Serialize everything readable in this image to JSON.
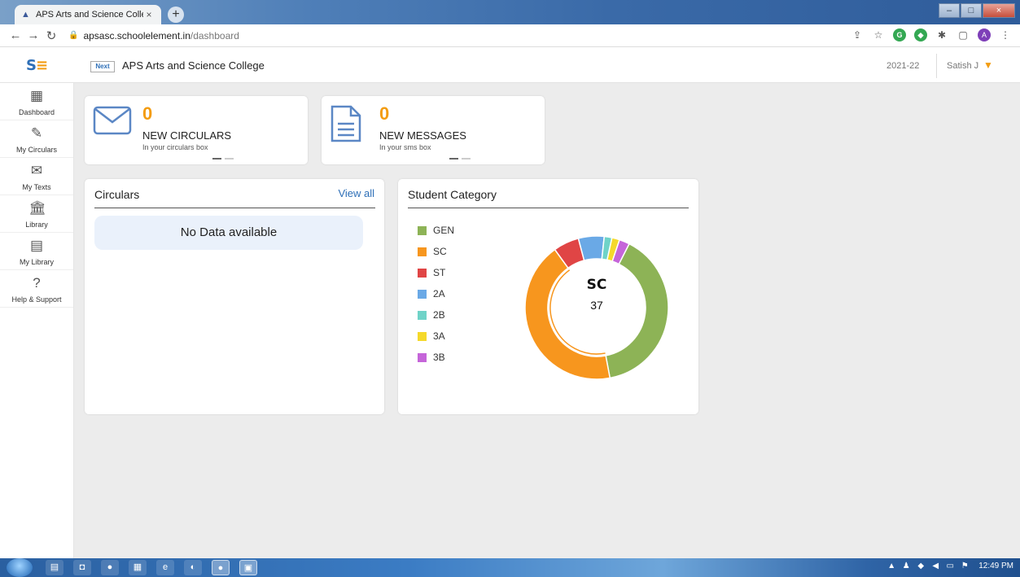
{
  "browser": {
    "tab_title": "APS Arts and Science College",
    "new_tab": "+",
    "url_host": "apsasc.schoolelement.in",
    "url_path": "/dashboard"
  },
  "header": {
    "logo_primary": "S",
    "logo_accent": "≡",
    "brand_mark": "Next",
    "college_name": "APS Arts and Science College",
    "academic_year": "2021-22",
    "user_name": "Satish J"
  },
  "sidebar": {
    "items": [
      {
        "label": "Dashboard",
        "icon": "dashboard-icon"
      },
      {
        "label": "My Circulars",
        "icon": "circulars-icon"
      },
      {
        "label": "My Texts",
        "icon": "texts-icon"
      },
      {
        "label": "Library",
        "icon": "library-icon"
      },
      {
        "label": "My Library",
        "icon": "my-library-icon"
      },
      {
        "label": "Help & Support",
        "icon": "help-icon"
      }
    ]
  },
  "stats": {
    "circulars": {
      "count": "0",
      "title": "NEW CIRCULARS",
      "subtitle": "In your circulars box"
    },
    "messages": {
      "count": "0",
      "title": "NEW MESSAGES",
      "subtitle": "In your sms box"
    }
  },
  "circulars_panel": {
    "title": "Circulars",
    "view_all": "View all",
    "empty_text": "No Data available"
  },
  "category_panel": {
    "title": "Student Category",
    "center_label": "SC",
    "center_value": "37"
  },
  "chart_data": {
    "type": "pie",
    "categories": [
      "GEN",
      "SC",
      "ST",
      "2A",
      "2B",
      "3A",
      "3B"
    ],
    "values": [
      34,
      37,
      5,
      5,
      1.5,
      1.5,
      2
    ],
    "colors": [
      "#8db356",
      "#f7961e",
      "#e04545",
      "#6aa9e6",
      "#6fd3c8",
      "#f5d92b",
      "#c565d9"
    ],
    "highlighted": "SC",
    "legend_position": "left"
  },
  "taskbar": {
    "clock": "12:49 PM"
  }
}
